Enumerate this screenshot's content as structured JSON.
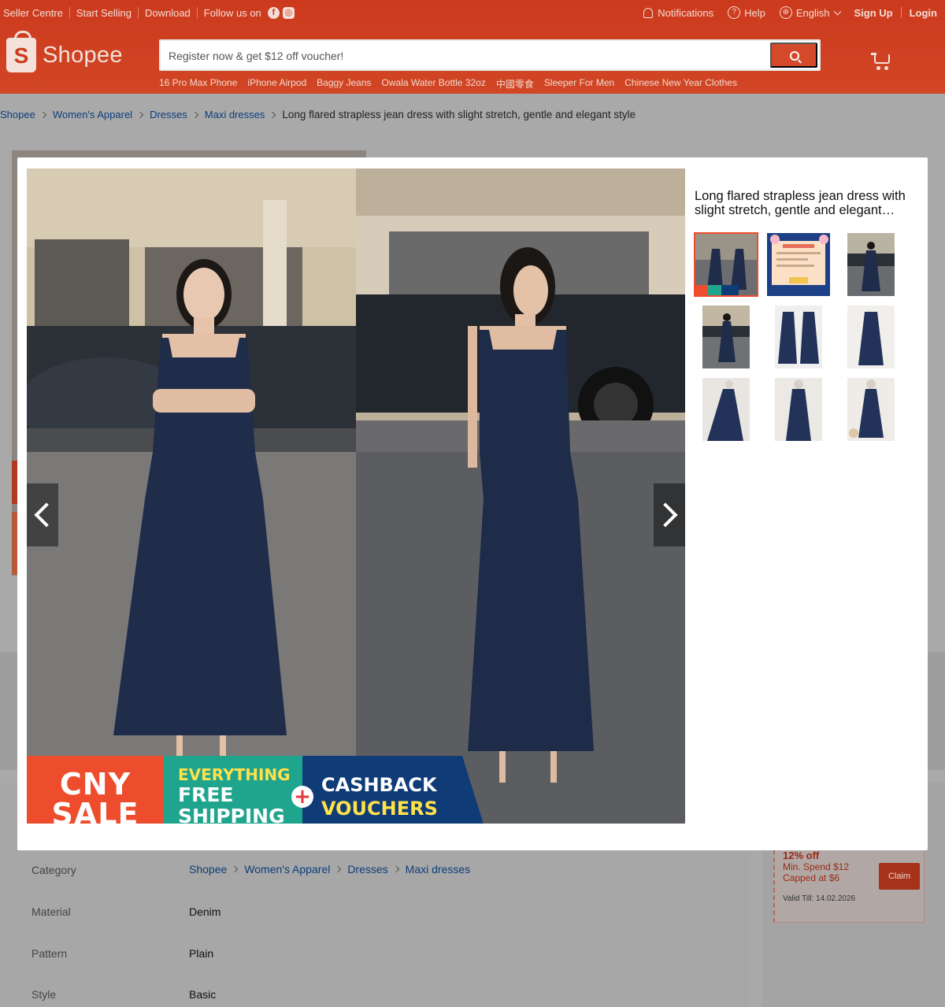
{
  "topbar": {
    "left_items": [
      "Seller Centre",
      "Start Selling",
      "Download"
    ],
    "follow_label": "Follow us on",
    "social_icons": [
      "facebook-icon",
      "instagram-icon"
    ],
    "notifications": "Notifications",
    "help": "Help",
    "language": "English",
    "signup": "Sign Up",
    "login": "Login"
  },
  "brand": {
    "logo_text": "Shopee",
    "color": "#ee4d2d"
  },
  "search": {
    "placeholder": "Register now & get $12 off voucher!",
    "suggestions": [
      "16 Pro Max Phone",
      "iPhone Airpod",
      "Baggy Jeans",
      "Owala Water Bottle 32oz",
      "中國零食",
      "Sleeper For Men",
      "Chinese New Year Clothes"
    ]
  },
  "breadcrumb": {
    "links": [
      "Shopee",
      "Women's Apparel",
      "Dresses",
      "Maxi dresses"
    ],
    "current": "Long flared strapless jean dress with slight stretch, gentle and elegant style"
  },
  "modal": {
    "title": "Long flared strapless jean dress with slight stretch, gentle and elegant…",
    "promo": {
      "cny_line1": "CNY",
      "cny_line2": "SALE",
      "ship_line1": "EVERYTHING",
      "ship_line2": "FREE",
      "ship_line3": "SHIPPING",
      "plus": "+",
      "cash_line1": "CASHBACK",
      "cash_line2": "VOUCHERS"
    },
    "thumbnail_count": 9,
    "active_thumbnail": 1
  },
  "specs": [
    {
      "label": "Category",
      "breadcrumb": [
        "Shopee",
        "Women's Apparel",
        "Dresses",
        "Maxi dresses"
      ]
    },
    {
      "label": "Material",
      "value": "Denim"
    },
    {
      "label": "Pattern",
      "value": "Plain"
    },
    {
      "label": "Style",
      "value": "Basic"
    }
  ],
  "voucher": {
    "discount": "12% off",
    "min_spend": "Min. Spend $12",
    "capped": "Capped at $6",
    "valid": "Valid Till: 14.02.2026",
    "claim": "Claim"
  }
}
